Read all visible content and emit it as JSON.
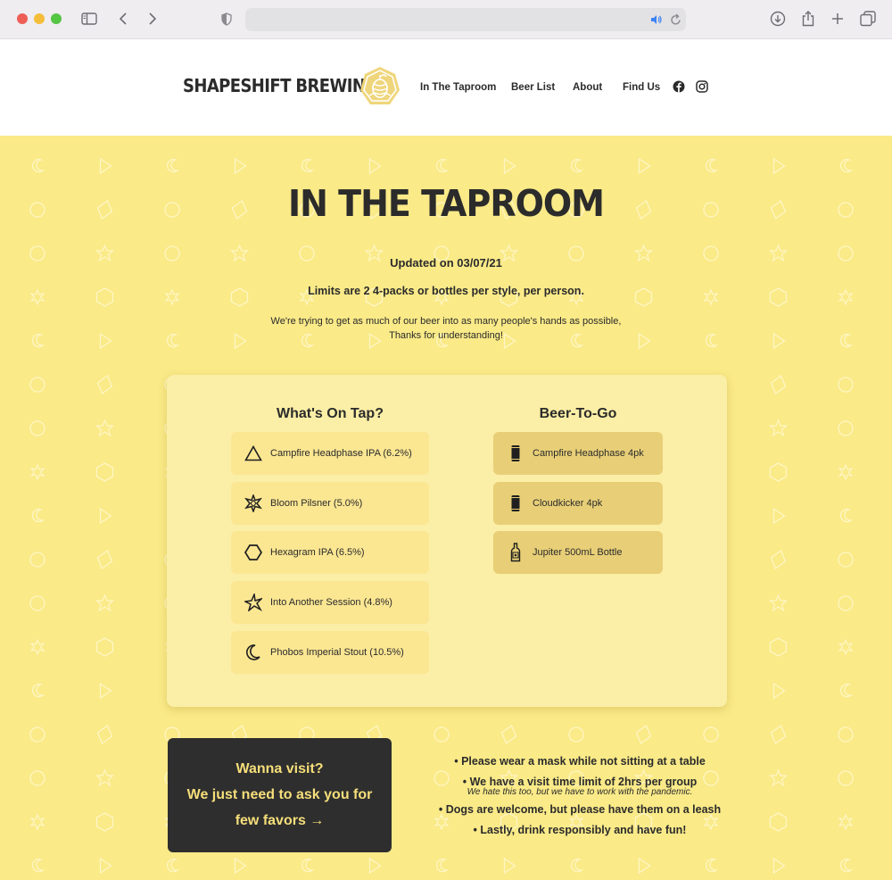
{
  "site": {
    "logo_text": "SHAPESHIFT BREWING",
    "nav": [
      "In The Taproom",
      "Beer List",
      "About",
      "Find Us"
    ],
    "social_icons": [
      "facebook-icon",
      "instagram-icon"
    ]
  },
  "page": {
    "title": "IN THE TAPROOM",
    "updated": "Updated on 03/07/21",
    "limits": "Limits are 2 4-packs or bottles per style, per person.",
    "note_line1": "We're trying to get as much of our beer into as many people's hands as possible,",
    "note_line2": "Thanks for understanding!"
  },
  "on_tap": {
    "title": "What's On Tap?",
    "items": [
      {
        "label": "Campfire Headphase IPA (6.2%)",
        "icon": "triangle-icon"
      },
      {
        "label": "Bloom Pilsner (5.0%)",
        "icon": "star-burst-icon"
      },
      {
        "label": "Hexagram IPA (6.5%)",
        "icon": "hexagon-icon"
      },
      {
        "label": "Into Another Session (4.8%)",
        "icon": "spiky-star-icon"
      },
      {
        "label": "Phobos Imperial Stout (10.5%)",
        "icon": "crescent-moon-icon"
      }
    ]
  },
  "to_go": {
    "title": "Beer-To-Go",
    "items": [
      {
        "label": "Campfire Headphase 4pk",
        "icon": "can-icon"
      },
      {
        "label": "Cloudkicker 4pk",
        "icon": "can-icon"
      },
      {
        "label": "Jupiter 500mL Bottle",
        "icon": "bottle-icon"
      }
    ]
  },
  "visit": {
    "line1": "Wanna visit?",
    "line2": "We just need to ask you for",
    "line3": "few favors →"
  },
  "rules": {
    "r1": "• Please wear a mask while not sitting at a table",
    "r2": "• We have a visit time limit of 2hrs per group",
    "r2_sub": "We hate this too, but we have to work with the pandemic.",
    "r3": "• Dogs are welcome, but please have them on a leash",
    "r4": "• Lastly, drink responsibly and have fun!"
  },
  "colors": {
    "background_yellow": "#faea88",
    "panel": "#fbeea6",
    "tap_item": "#fbe692",
    "togo_item": "#e8cf77",
    "dark": "#2e2e2e",
    "accent_text": "#f6df7a"
  }
}
